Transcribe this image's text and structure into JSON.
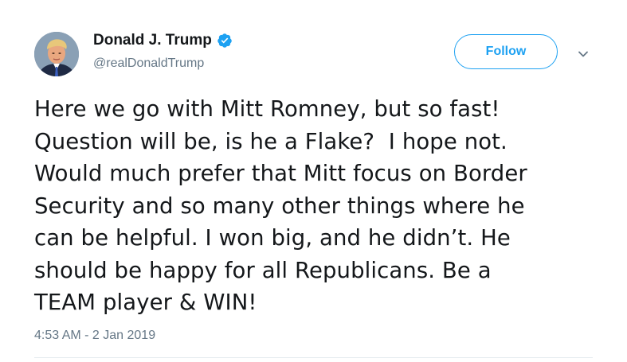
{
  "author": {
    "display_name": "Donald J. Trump",
    "handle": "@realDonaldTrump",
    "verified": true,
    "avatar_icon": "profile-photo"
  },
  "actions": {
    "follow_label": "Follow",
    "menu_icon": "chevron-down-icon"
  },
  "tweet": {
    "lines": [
      "Here we go with Mitt Romney, but so fast!",
      "Question will be, is he a Flake?  I hope not.",
      "Would much prefer that Mitt focus on Border",
      "Security and so many other things where he",
      "can be helpful. I won big, and he didn’t. He",
      "should be happy for all Republicans. Be a",
      "TEAM player & WIN!"
    ],
    "timestamp": "4:53 AM - 2 Jan 2019"
  },
  "colors": {
    "accent": "#1da1f2",
    "text": "#14171a",
    "muted": "#657786",
    "divider": "#e6ecf0"
  }
}
